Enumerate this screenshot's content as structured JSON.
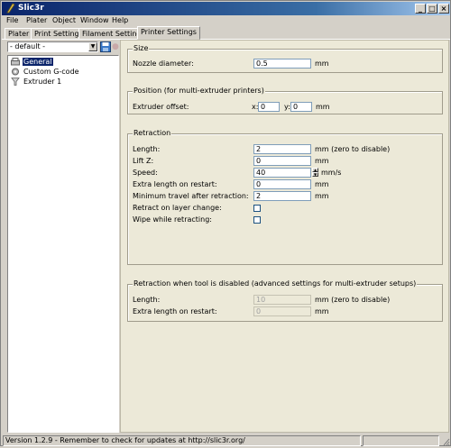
{
  "window": {
    "title": "Slic3r",
    "minimize": "_",
    "maximize": "□",
    "close": "×"
  },
  "menu": [
    "File",
    "Plater",
    "Object",
    "Window",
    "Help"
  ],
  "tabs": [
    "Plater",
    "Print Settings",
    "Filament Settings",
    "Printer Settings"
  ],
  "active_tab": "Printer Settings",
  "sidebar": {
    "preset": "- default -",
    "tree": [
      "General",
      "Custom G-code",
      "Extruder 1"
    ],
    "selected": "General"
  },
  "size": {
    "title": "Size",
    "nozzle_label": "Nozzle diameter:",
    "nozzle_value": "0.5",
    "nozzle_unit": "mm"
  },
  "position": {
    "title": "Position (for multi-extruder printers)",
    "offset_label": "Extruder offset:",
    "x_label": "x:",
    "x_value": "0",
    "y_label": "y:",
    "y_value": "0",
    "unit": "mm"
  },
  "retraction": {
    "title": "Retraction",
    "length_label": "Length:",
    "length_value": "2",
    "length_unit": "mm (zero to disable)",
    "liftz_label": "Lift Z:",
    "liftz_value": "0",
    "liftz_unit": "mm",
    "speed_label": "Speed:",
    "speed_value": "40",
    "speed_unit": "mm/s",
    "extra_label": "Extra length on restart:",
    "extra_value": "0",
    "extra_unit": "mm",
    "travel_label": "Minimum travel after retraction:",
    "travel_value": "2",
    "travel_unit": "mm",
    "layer_label": "Retract on layer change:",
    "wipe_label": "Wipe while retracting:"
  },
  "disabled": {
    "title": "Retraction when tool is disabled (advanced settings for multi-extruder setups)",
    "length_label": "Length:",
    "length_value": "10",
    "length_unit": "mm (zero to disable)",
    "extra_label": "Extra length on restart:",
    "extra_value": "0",
    "extra_unit": "mm"
  },
  "status": "Version 1.2.9 - Remember to check for updates at http://slic3r.org/",
  "colors": {
    "title_bar": "#0a246a",
    "selection": "#0a246a",
    "panel_bg": "#ece9d8"
  }
}
